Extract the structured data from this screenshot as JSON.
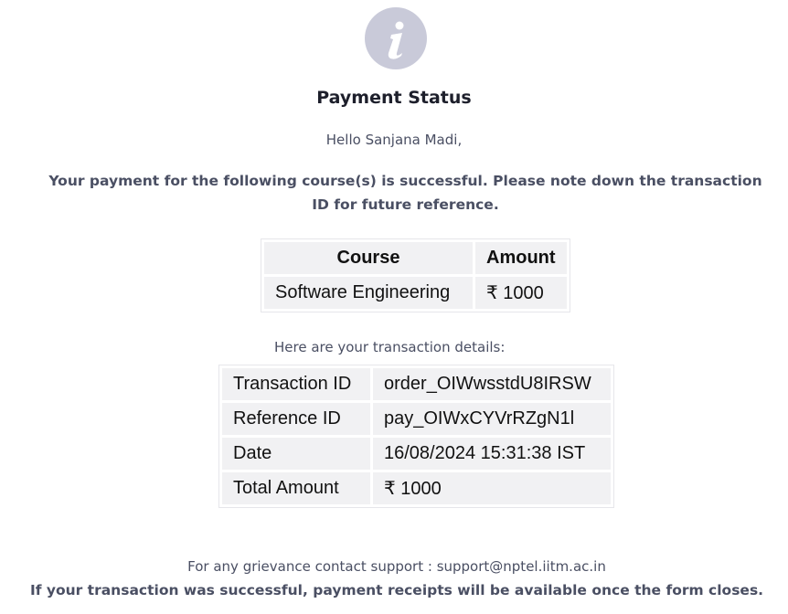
{
  "header": {
    "icon": "info-icon",
    "icon_color": "#c9cad9",
    "title": "Payment Status"
  },
  "greeting": "Hello Sanjana Madi,",
  "success_message": "Your payment for the following course(s) is successful. Please note down the transaction ID for future reference.",
  "course_table": {
    "headers": [
      "Course",
      "Amount"
    ],
    "rows": [
      {
        "course": "Software Engineering",
        "amount": "₹ 1000"
      }
    ]
  },
  "details_intro": "Here are your transaction details:",
  "transaction": {
    "rows": [
      {
        "label": "Transaction ID",
        "value": "order_OIWwsstdU8IRSW"
      },
      {
        "label": "Reference ID",
        "value": "pay_OIWxCYVrRZgN1l"
      },
      {
        "label": "Date",
        "value": "16/08/2024 15:31:38 IST"
      },
      {
        "label": "Total Amount",
        "value": "₹ 1000"
      }
    ]
  },
  "footer": {
    "support": "For any grievance contact support : support@nptel.iitm.ac.in",
    "receipt_note": "If your transaction was successful, payment receipts will be available once the form closes."
  }
}
